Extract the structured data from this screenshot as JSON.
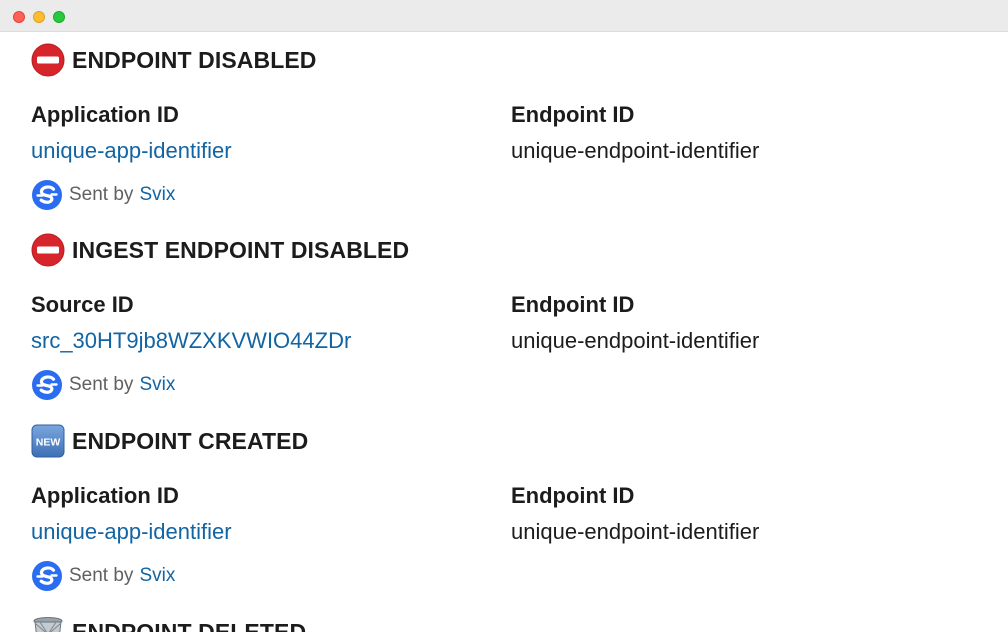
{
  "messages": [
    {
      "icon": "no-entry-icon",
      "title": "ENDPOINT DISABLED",
      "left_label": "Application ID",
      "left_value": "unique-app-identifier",
      "right_label": "Endpoint ID",
      "right_value": "unique-endpoint-identifier",
      "sent_prefix": "Sent by",
      "sent_link": "Svix"
    },
    {
      "icon": "no-entry-icon",
      "title": "INGEST ENDPOINT DISABLED",
      "left_label": "Source ID",
      "left_value": "src_30HT9jb8WZXKVWIO44ZDr",
      "right_label": "Endpoint ID",
      "right_value": "unique-endpoint-identifier",
      "sent_prefix": "Sent by",
      "sent_link": "Svix"
    },
    {
      "icon": "new-badge-icon",
      "icon_text": "NEW",
      "title": "ENDPOINT CREATED",
      "left_label": "Application ID",
      "left_value": "unique-app-identifier",
      "right_label": "Endpoint ID",
      "right_value": "unique-endpoint-identifier",
      "sent_prefix": "Sent by",
      "sent_link": "Svix"
    },
    {
      "icon": "wastebasket-icon",
      "title": "ENDPOINT DELETED"
    }
  ],
  "colors": {
    "link": "#1264a3",
    "text": "#1d1c1d",
    "muted": "#616061",
    "no_entry": "#d6252b",
    "new_badge": "#4a80c7",
    "svix": "#2b6df0"
  }
}
